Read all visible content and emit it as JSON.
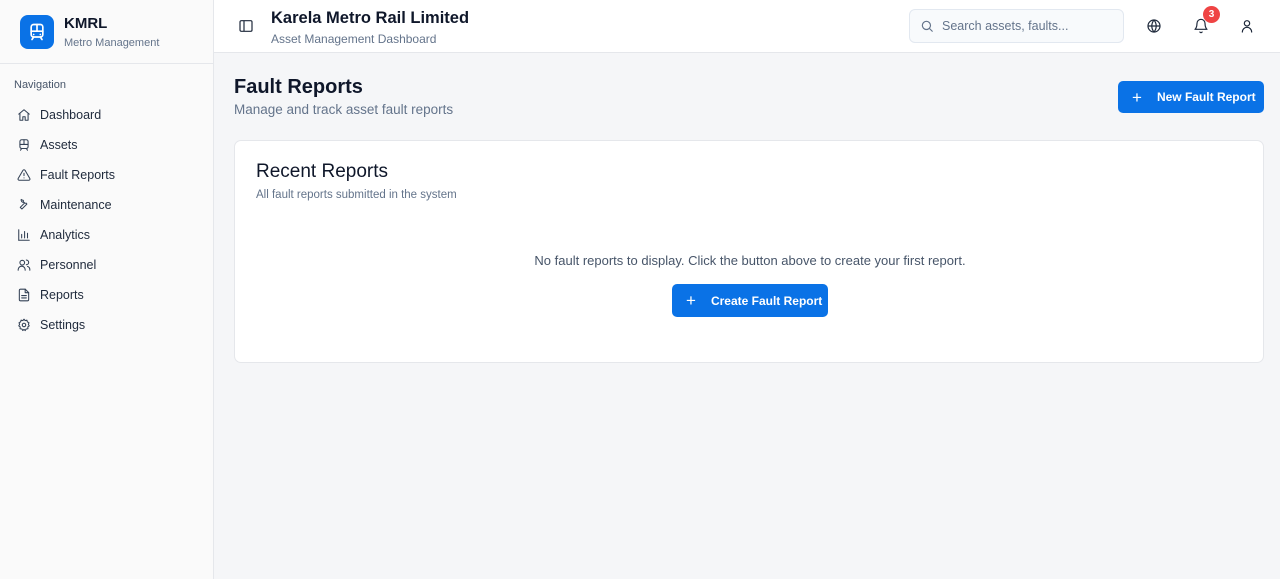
{
  "brand": {
    "name": "KMRL",
    "subtitle": "Metro Management"
  },
  "sidebar": {
    "nav_title": "Navigation",
    "items": [
      {
        "label": "Dashboard",
        "icon": "home-icon"
      },
      {
        "label": "Assets",
        "icon": "train-icon"
      },
      {
        "label": "Fault Reports",
        "icon": "alert-triangle-icon"
      },
      {
        "label": "Maintenance",
        "icon": "wrench-icon"
      },
      {
        "label": "Analytics",
        "icon": "bar-chart-icon"
      },
      {
        "label": "Personnel",
        "icon": "users-icon"
      },
      {
        "label": "Reports",
        "icon": "file-text-icon"
      },
      {
        "label": "Settings",
        "icon": "gear-icon"
      }
    ]
  },
  "header": {
    "title": "Karela Metro Rail Limited",
    "subtitle": "Asset Management Dashboard",
    "search_placeholder": "Search assets, faults...",
    "notification_count": "3"
  },
  "main": {
    "title": "Fault Reports",
    "subtitle": "Manage and track asset fault reports",
    "new_button_label": "New Fault Report",
    "card": {
      "title": "Recent Reports",
      "subtitle": "All fault reports submitted in the system",
      "empty_message": "No fault reports to display. Click the button above to create your first report.",
      "create_button_label": "Create Fault Report"
    }
  },
  "colors": {
    "accent": "#0a72e6",
    "badge": "#ef4444",
    "background": "#f5f6f8"
  }
}
